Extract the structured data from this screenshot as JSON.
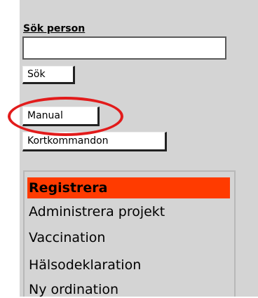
{
  "search": {
    "title": "Sök person",
    "input_value": "",
    "button_label": "Sök"
  },
  "buttons": {
    "manual_label": "Manual",
    "shortcuts_label": "Kortkommandon"
  },
  "menu": {
    "header": "Registrera",
    "items": [
      "Administrera projekt",
      "Vaccination",
      "Hälsodeklaration",
      "Ny ordination"
    ]
  },
  "colors": {
    "panel_bg": "#d4d4d4",
    "menu_header_bg": "#ff3b00",
    "highlight_ring": "#e21b1b"
  }
}
